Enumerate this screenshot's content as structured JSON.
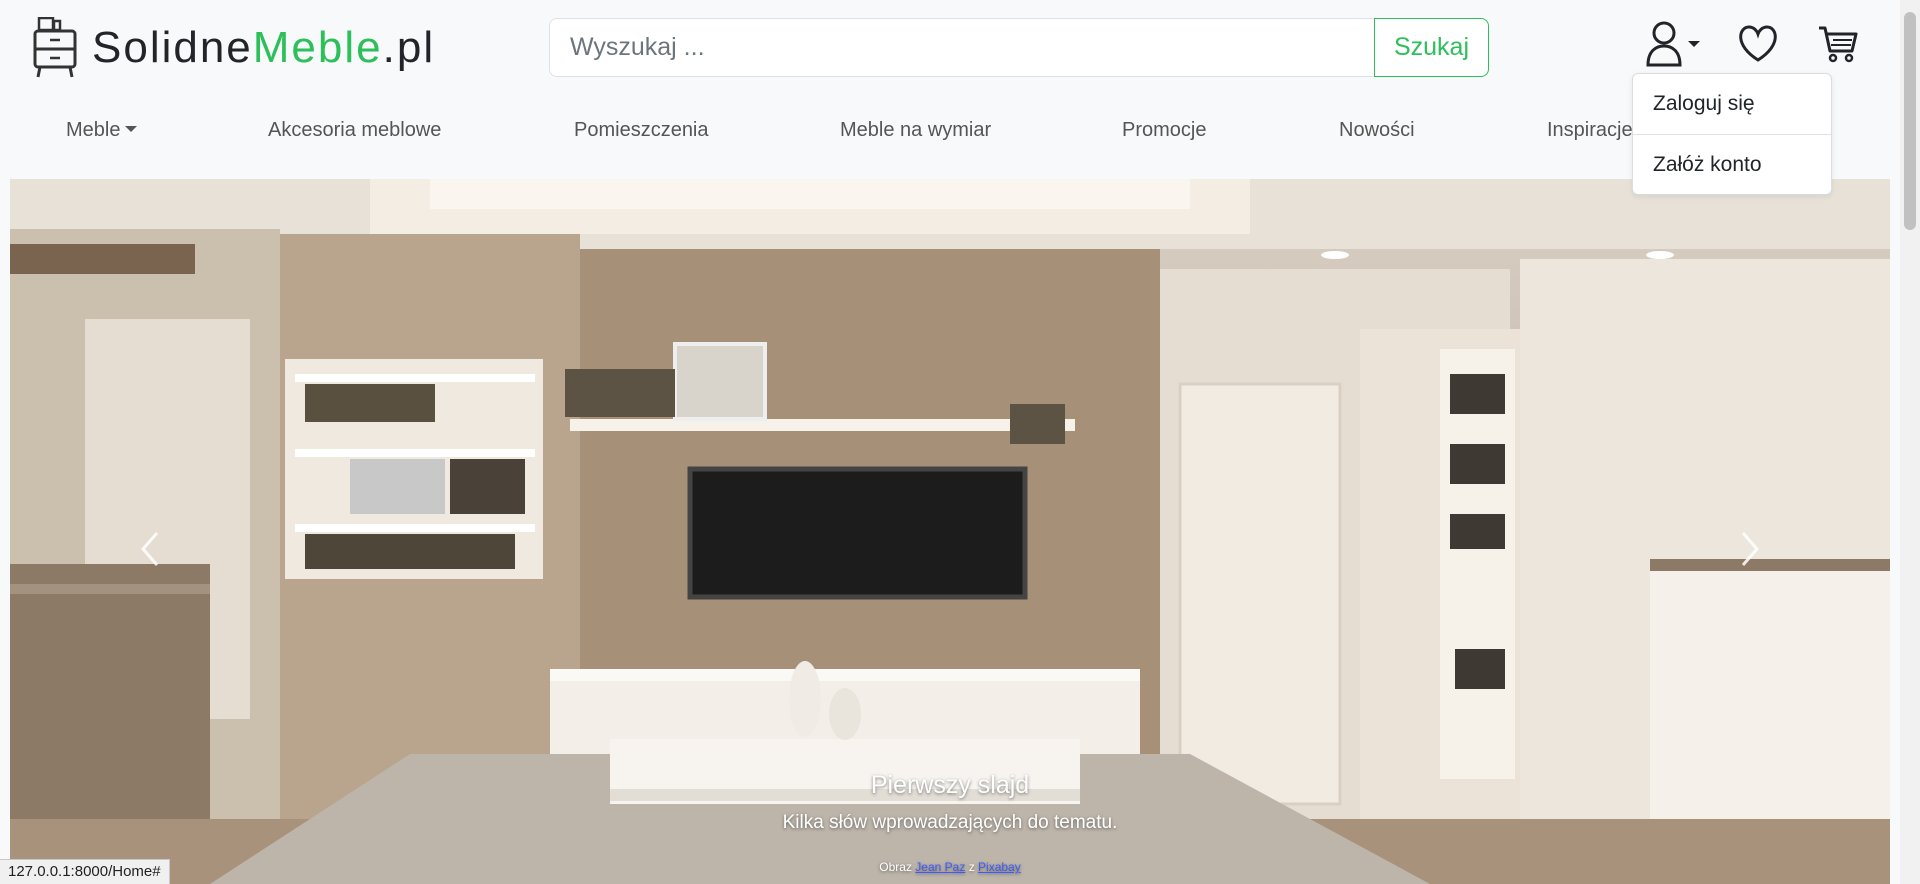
{
  "logo": {
    "part1": "Solidne",
    "part2": "Meble",
    "part3": ".pl"
  },
  "colors": {
    "accent": "#2dbf5a"
  },
  "search": {
    "placeholder": "Wyszukaj ...",
    "button_label": "Szukaj"
  },
  "header_icons": [
    "user-icon",
    "heart-icon",
    "cart-icon"
  ],
  "nav": {
    "items": [
      {
        "label": "Meble",
        "has_dropdown": true
      },
      {
        "label": "Akcesoria meblowe"
      },
      {
        "label": "Pomieszczenia"
      },
      {
        "label": "Meble na wymiar"
      },
      {
        "label": "Promocje"
      },
      {
        "label": "Nowości"
      },
      {
        "label": "Inspiracje"
      }
    ]
  },
  "account_menu": {
    "items": [
      {
        "label": "Zaloguj się"
      },
      {
        "label": "Załóż konto"
      }
    ]
  },
  "carousel": {
    "slide_title": "Pierwszy slajd",
    "slide_text": "Kilka słów wprowadzających do tematu.",
    "credit_prefix": "Obraz",
    "credit_author": "Jean Paz",
    "credit_mid": "z",
    "credit_source": "Pixabay"
  },
  "status_bar": {
    "url": "127.0.0.1:8000/Home#"
  }
}
